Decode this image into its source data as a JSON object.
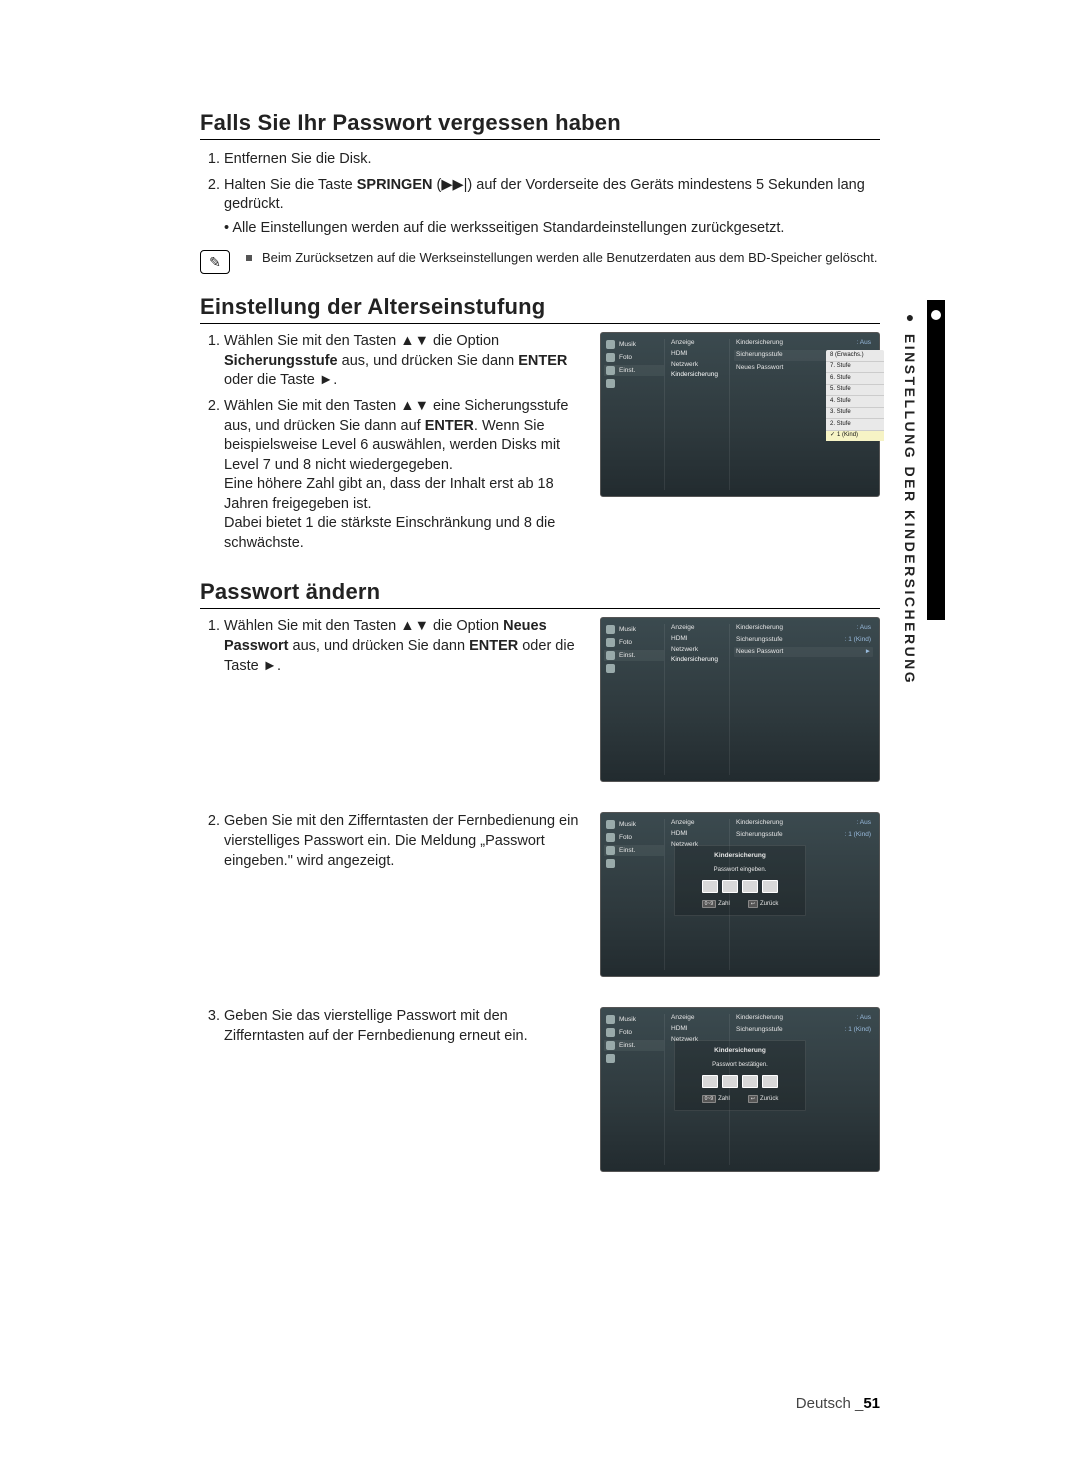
{
  "sidebar_tab": "EINSTELLUNG DER KINDERSICHERUNG",
  "sec_forgot": {
    "title": "Falls Sie Ihr Passwort vergessen haben",
    "steps": [
      "Entfernen Sie die Disk.",
      [
        "Halten Sie die Taste ",
        "SPRINGEN",
        " (",
        "▶▶|",
        ") auf der Vorderseite des Geräts mindestens 5 Sekunden lang gedrückt."
      ]
    ],
    "sub_bullet": "Alle Einstellungen werden auf die werksseitigen Standardeinstellungen zurückgesetzt.",
    "note": "Beim Zurücksetzen auf die Werkseinstellungen werden alle Benutzerdaten aus dem BD-Speicher gelöscht."
  },
  "sec_rating": {
    "title": "Einstellung der Alterseinstufung",
    "step1": [
      "Wählen Sie mit den Tasten ▲▼ die Option ",
      "Sicherungsstufe",
      " aus, und drücken Sie dann ",
      "ENTER",
      " oder die Taste ►."
    ],
    "step2": [
      "Wählen Sie mit den Tasten ▲▼ eine Sicherungsstufe aus, und drücken Sie dann auf ",
      "ENTER",
      ". Wenn Sie beispielsweise Level 6 auswählen, werden Disks mit Level 7 und 8 nicht wiedergegeben.",
      "Eine höhere Zahl gibt an, dass der Inhalt erst ab 18 Jahren freigegeben ist.",
      "Dabei bietet 1 die stärkste Einschränkung und 8 die schwächste."
    ]
  },
  "sec_password": {
    "title": "Passwort ändern",
    "step1": [
      "Wählen Sie mit den Tasten ▲▼ die Option ",
      "Neues Passwort",
      " aus, und drücken Sie dann ",
      "ENTER",
      " oder die Taste ►."
    ],
    "step2": "Geben Sie mit den Zifferntasten der Fernbedienung ein vierstelliges Passwort ein. Die Meldung „Passwort eingeben.\" wird angezeigt.",
    "step3": "Geben Sie das vierstellige Passwort mit den Zifferntasten auf der Fernbedienung erneut ein."
  },
  "osd": {
    "left": [
      {
        "icon": true,
        "label": "Musik"
      },
      {
        "icon": true,
        "label": "Foto"
      },
      {
        "icon": true,
        "label": "Einst.",
        "sel": true
      },
      {
        "icon": true,
        "label": ""
      }
    ],
    "mid": [
      "Anzeige",
      "HDMI",
      "Netzwerk",
      "Kindersicherung"
    ],
    "right_parental": {
      "kinder": {
        "label": "Kindersicherung",
        "value": "Aus"
      },
      "stufe": {
        "label": "Sicherungsstufe",
        "value": ""
      },
      "pass": {
        "label": "Neues Passwort",
        "value": ""
      }
    },
    "right_parental2": {
      "kinder": {
        "label": "Kindersicherung",
        "value": "Aus"
      },
      "stufe": {
        "label": "Sicherungsstufe",
        "value": "1 (Kind)"
      },
      "pass": {
        "label": "Neues Passwort",
        "value": "►"
      }
    },
    "dropdown": [
      "8 (Erwachs.)",
      "7. Stufe",
      "6. Stufe",
      "5. Stufe",
      "4. Stufe",
      "3. Stufe",
      "2. Stufe",
      "1 (Kind)"
    ],
    "modal": {
      "title": "Kindersicherung",
      "sub_enter": "Passwort eingeben.",
      "sub_confirm": "Passwort bestätigen.",
      "hint_num_key": "0~9",
      "hint_num": "Zahl",
      "hint_ret_key": "↩",
      "hint_ret": "Zurück"
    }
  },
  "footer": {
    "lang": "Deutsch _",
    "page": "51"
  }
}
